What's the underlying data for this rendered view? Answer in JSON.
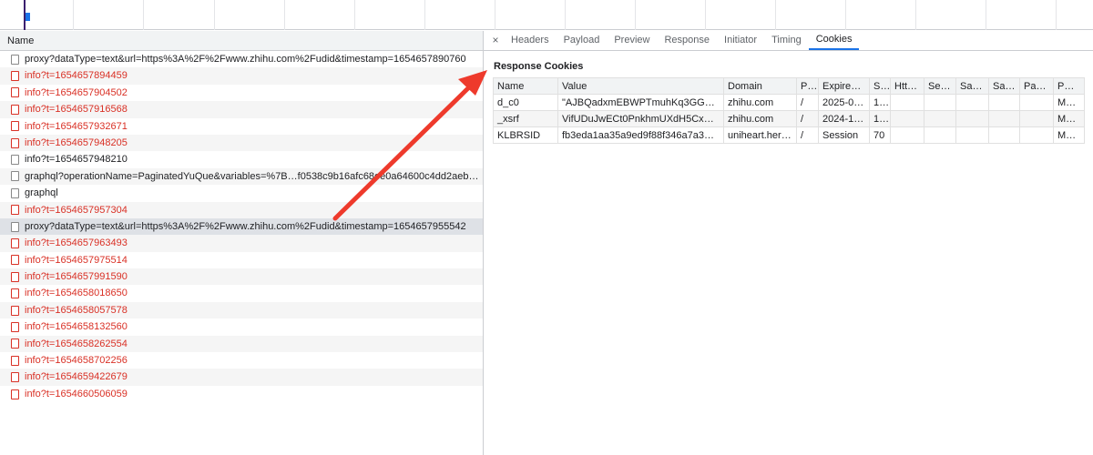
{
  "list": {
    "header": "Name",
    "requests": [
      {
        "name": "proxy?dataType=text&url=https%3A%2F%2Fwww.zhihu.com%2Fudid&timestamp=1654657890760",
        "status": "ok"
      },
      {
        "name": "info?t=1654657894459",
        "status": "error"
      },
      {
        "name": "info?t=1654657904502",
        "status": "error"
      },
      {
        "name": "info?t=1654657916568",
        "status": "error"
      },
      {
        "name": "info?t=1654657932671",
        "status": "error"
      },
      {
        "name": "info?t=1654657948205",
        "status": "error"
      },
      {
        "name": "info?t=1654657948210",
        "status": "ok"
      },
      {
        "name": "graphql?operationName=PaginatedYuQue&variables=%7B…f0538c9b16afc68ee0a64600c4dd2aeb2f1…",
        "status": "ok"
      },
      {
        "name": "graphql",
        "status": "ok"
      },
      {
        "name": "info?t=1654657957304",
        "status": "error"
      },
      {
        "name": "proxy?dataType=text&url=https%3A%2F%2Fwww.zhihu.com%2Fudid&timestamp=1654657955542",
        "status": "ok",
        "selected": true
      },
      {
        "name": "info?t=1654657963493",
        "status": "error"
      },
      {
        "name": "info?t=1654657975514",
        "status": "error"
      },
      {
        "name": "info?t=1654657991590",
        "status": "error"
      },
      {
        "name": "info?t=1654658018650",
        "status": "error"
      },
      {
        "name": "info?t=1654658057578",
        "status": "error"
      },
      {
        "name": "info?t=1654658132560",
        "status": "error"
      },
      {
        "name": "info?t=1654658262554",
        "status": "error"
      },
      {
        "name": "info?t=1654658702256",
        "status": "error"
      },
      {
        "name": "info?t=1654659422679",
        "status": "error"
      },
      {
        "name": "info?t=1654660506059",
        "status": "error"
      }
    ]
  },
  "details": {
    "close_glyph": "×",
    "tabs": [
      "Headers",
      "Payload",
      "Preview",
      "Response",
      "Initiator",
      "Timing",
      "Cookies"
    ],
    "active_tab": "Cookies",
    "section_title": "Response Cookies",
    "cookie_columns": [
      "Name",
      "Value",
      "Domain",
      "P…",
      "Expires …",
      "S…",
      "Htt…",
      "Se…",
      "Sa…",
      "Sa…",
      "Par…",
      "P…"
    ],
    "cookies": [
      [
        "d_c0",
        "\"AJBQadxmEBWPTmuhKq3GGks…",
        "zhihu.com",
        "/",
        "2025-0…",
        "1…",
        "",
        "",
        "",
        "",
        "",
        "Me…"
      ],
      [
        "_xsrf",
        "VifUDuJwECt0PnkhmUXdH5Cxm…",
        "zhihu.com",
        "/",
        "2024-1…",
        "1…",
        "",
        "",
        "",
        "",
        "",
        "Me…"
      ],
      [
        "KLBRSID",
        "fb3eda1aa35a9ed9f88f346a7a3eb…",
        "uniheart.her…",
        "/",
        "Session",
        "70",
        "",
        "",
        "",
        "",
        "",
        "Me…"
      ]
    ]
  },
  "colors": {
    "error_text": "#d93025",
    "active_tab_underline": "#1a73e8",
    "annotation_arrow": "#ee3a2c"
  }
}
